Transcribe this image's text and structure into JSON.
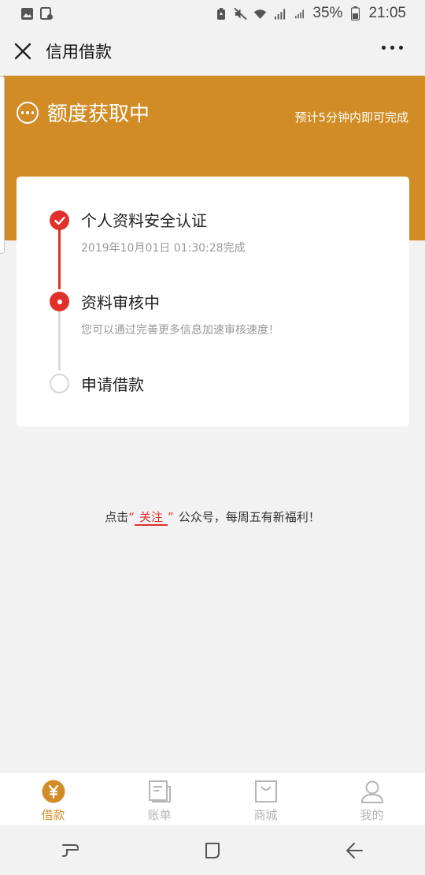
{
  "status_bar": {
    "battery_percent": "35%",
    "time": "21:05",
    "icons": [
      "gallery-icon",
      "screenshot-icon",
      "battery-saver-icon",
      "mute-icon",
      "wifi-icon",
      "signal-4g-icon",
      "signal-2g-icon",
      "battery-icon"
    ]
  },
  "header": {
    "title": "信用借款",
    "close_icon": "close-icon",
    "more_icon": "more-icon"
  },
  "banner": {
    "title": "额度获取中",
    "eta": "预计5分钟内即可完成",
    "color": "#d28c26"
  },
  "steps": [
    {
      "title": "个人资料安全认证",
      "subtitle": "2019年10月01日 01:30:28完成",
      "state": "done"
    },
    {
      "title": "资料审核中",
      "subtitle": "您可以通过完善更多信息加速审核速度！",
      "state": "active"
    },
    {
      "title": "申请借款",
      "subtitle": "",
      "state": "pending"
    }
  ],
  "follow_tip": {
    "prefix": "点击",
    "open_quote": "“",
    "link": "关注",
    "close_quote": "”",
    "suffix": "公众号，每周五有新福利！"
  },
  "tabs": [
    {
      "label": "借款",
      "icon": "yuan-coin-icon",
      "active": true
    },
    {
      "label": "账单",
      "icon": "bill-icon",
      "active": false
    },
    {
      "label": "商城",
      "icon": "shopping-bag-icon",
      "active": false
    },
    {
      "label": "我的",
      "icon": "person-icon",
      "active": false
    }
  ],
  "colors": {
    "accent": "#d28c26",
    "progress_red": "#e1302a",
    "inactive": "#b5b5b5"
  }
}
